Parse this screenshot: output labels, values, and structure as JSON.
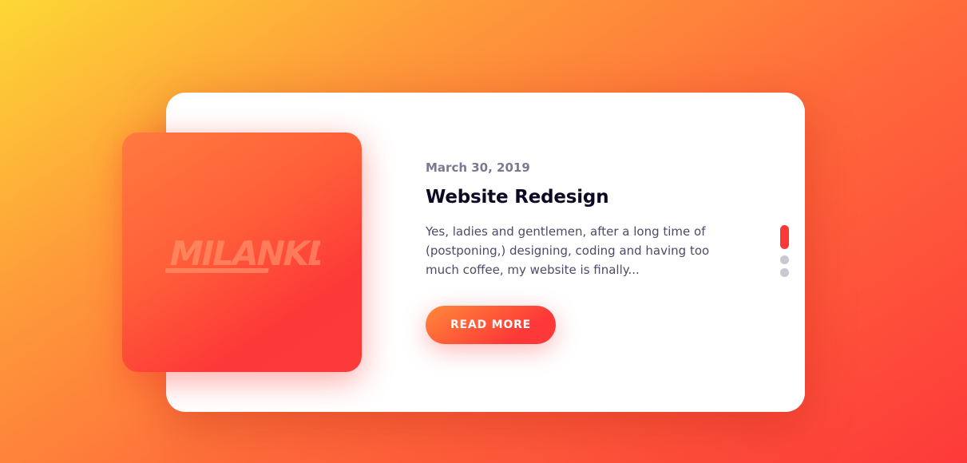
{
  "post": {
    "logo_text": "MILANKD",
    "date": "March 30, 2019",
    "title": "Website Redesign",
    "excerpt": "Yes, ladies and gentlemen, after a long time of (postponing,) designing, coding and having too much coffee, my website is finally...",
    "button_label": "READ MORE"
  },
  "pagination": {
    "count": 3,
    "active_index": 0
  },
  "colors": {
    "accent": "#fd3838",
    "accent_light": "#fe8a39",
    "title": "#0d0925",
    "date": "#7b7992",
    "text": "#4e4a67",
    "inactive_dot": "#c9c8d2"
  }
}
